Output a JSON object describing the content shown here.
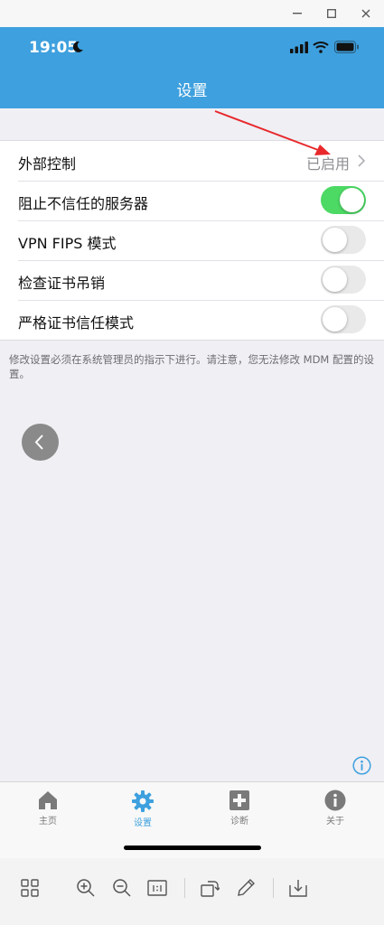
{
  "window": {
    "minimize_icon": "minimize-icon",
    "maximize_icon": "maximize-icon",
    "close_icon": "close-icon"
  },
  "status_bar": {
    "time": "19:05",
    "icons": [
      "moon-icon",
      "signal-icon",
      "wifi-icon",
      "battery-icon"
    ]
  },
  "header": {
    "title": "设置"
  },
  "settings": {
    "rows": [
      {
        "label": "外部控制",
        "value": "已启用",
        "type": "link"
      },
      {
        "label": "阻止不信任的服务器",
        "type": "toggle",
        "on": true
      },
      {
        "label": "VPN FIPS 模式",
        "type": "toggle",
        "on": false
      },
      {
        "label": "检查证书吊销",
        "type": "toggle",
        "on": false
      },
      {
        "label": "严格证书信任模式",
        "type": "toggle",
        "on": false
      }
    ],
    "footnote": "修改设置必须在系统管理员的指示下进行。请注意，您无法修改 MDM 配置的设置。"
  },
  "tabs": [
    {
      "label": "主页",
      "icon": "home-icon",
      "active": false
    },
    {
      "label": "设置",
      "icon": "gear-icon",
      "active": true
    },
    {
      "label": "诊断",
      "icon": "diagnostics-icon",
      "active": false
    },
    {
      "label": "关于",
      "icon": "info-icon",
      "active": false
    }
  ],
  "colors": {
    "header": "#3ea0de",
    "toggle_on": "#4cd964",
    "annotation_arrow": "#e8282b",
    "tab_active": "#3ea0de"
  }
}
